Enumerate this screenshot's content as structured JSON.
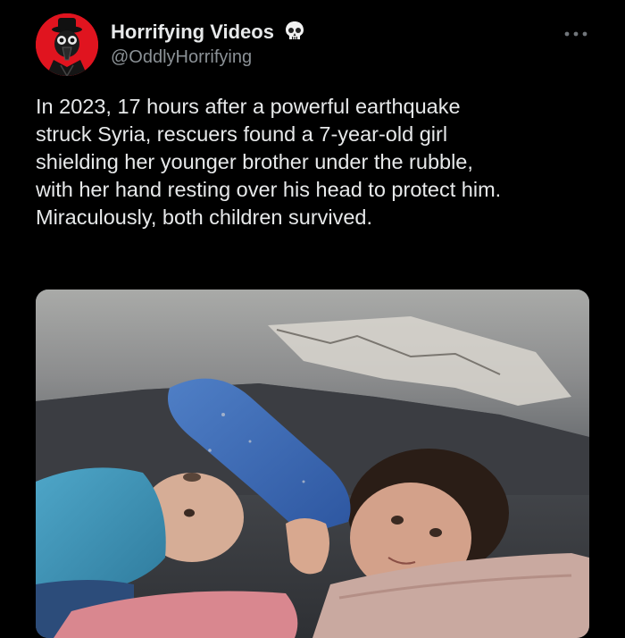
{
  "post": {
    "author": {
      "name": "Horrifying Videos",
      "handle": "@OddlyHorrifying",
      "badge_icon": "skull-icon",
      "avatar_icon": "plague-mask-avatar-icon"
    },
    "more_icon": "more-options-icon",
    "text_lines": [
      "In 2023, 17 hours after a powerful earthquake",
      "struck Syria, rescuers found a 7-year-old girl",
      "shielding her younger brother under the rubble,",
      "with her hand resting over his head to protect him.",
      "Miraculously, both children survived."
    ],
    "media": {
      "kind": "photo"
    }
  },
  "colors": {
    "background": "#000000",
    "text": "#e7e9ea",
    "secondary_text": "#8b9196",
    "avatar_bg": "#e0141f"
  }
}
